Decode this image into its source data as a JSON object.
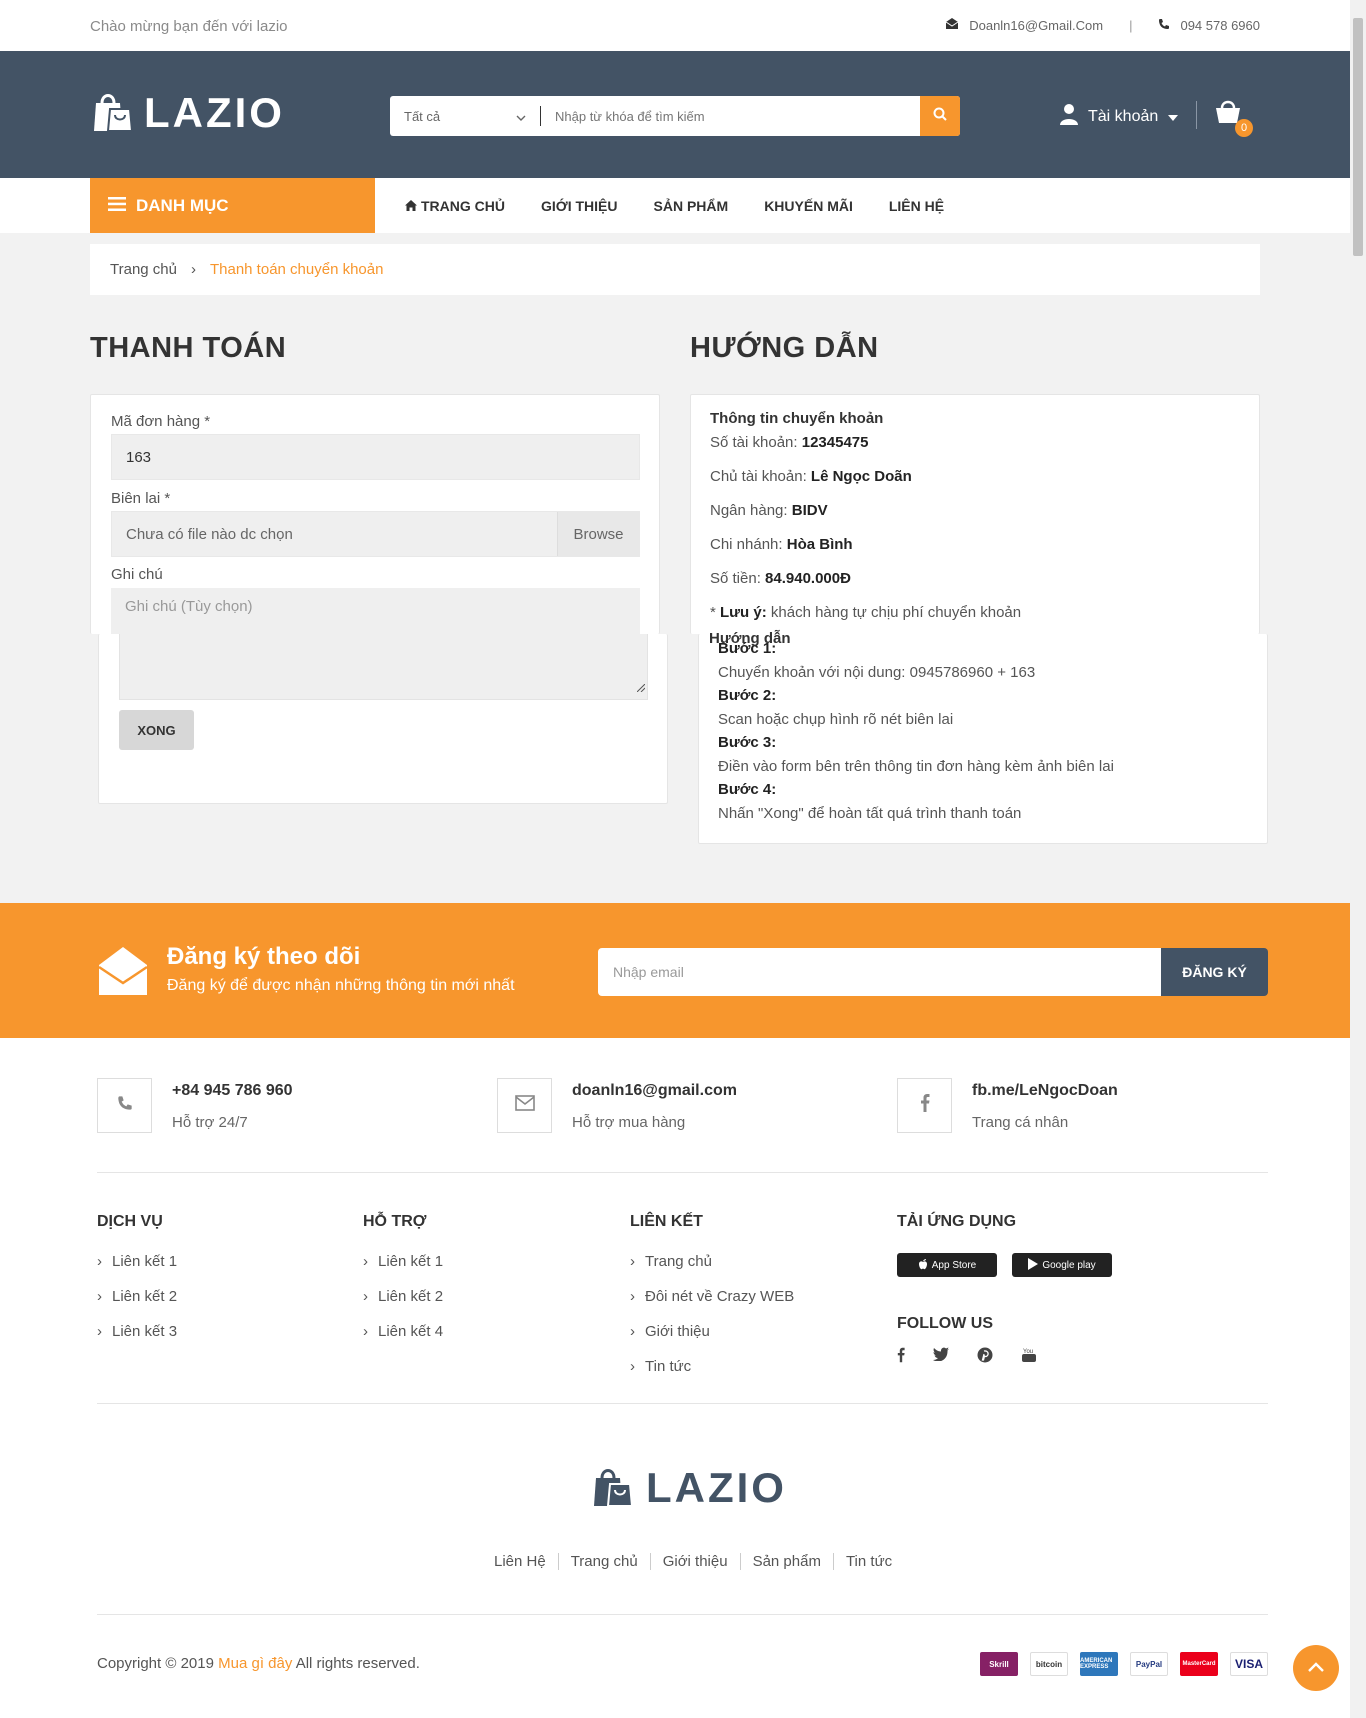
{
  "topbar": {
    "welcome": "Chào mừng bạn đến với lazio",
    "email": "Doanln16@Gmail.Com",
    "phone": "094 578 6960"
  },
  "header": {
    "logo": "LAZIO",
    "search_category": "Tất cả",
    "search_placeholder": "Nhập từ khóa để tìm kiếm",
    "account_label": "Tài khoản",
    "cart_count": "0",
    "brand_color": "#435365",
    "accent_color": "#f7962d"
  },
  "nav": {
    "category_label": "DANH MỤC",
    "items": [
      "TRANG CHỦ",
      "GIỚI THIỆU",
      "SẢN PHẨM",
      "KHUYẾN MÃI",
      "LIÊN HỆ"
    ]
  },
  "breadcrumb": {
    "home": "Trang chủ",
    "current": "Thanh toán chuyển khoản"
  },
  "payment": {
    "heading": "THANH TOÁN",
    "order_label": "Mã đơn hàng *",
    "order_value": "163",
    "receipt_label": "Biên lai *",
    "receipt_value": "Chưa có file nào dc chọn",
    "browse_label": "Browse",
    "note_label": "Ghi chú",
    "note_placeholder": "Ghi chú (Tùy chọn)",
    "submit_label": "XONG"
  },
  "guide": {
    "heading": "HƯỚNG DẪN",
    "info_title": "Thông tin chuyển khoản",
    "account_no_label": "Số tài khoản:",
    "account_no": "12345475",
    "owner_label": "Chủ tài khoản:",
    "owner": "Lê Ngọc Doãn",
    "bank_label": "Ngân hàng:",
    "bank": "BIDV",
    "branch_label": "Chi nhánh:",
    "branch": "Hòa Bình",
    "amount_label": "Số tiền:",
    "amount": "84.940.000Đ",
    "note_label": "Lưu ý:",
    "note": "khách hàng tự chịu phí chuyển khoản",
    "steps_title": "Hướng dẫn",
    "steps": [
      {
        "title": "Bước 1:",
        "text": "Chuyển khoản với nội dung: 0945786960 + 163"
      },
      {
        "title": "Bước 2:",
        "text": "Scan hoặc chụp hình rõ nét biên lai"
      },
      {
        "title": "Bước 3:",
        "text": "Điền vào form bên trên thông tin đơn hàng kèm ảnh biên lai"
      },
      {
        "title": "Bước 4:",
        "text": "Nhấn \"Xong\" để hoàn tất quá trình thanh toán"
      }
    ]
  },
  "subscribe": {
    "title": "Đăng ký theo dõi",
    "subtitle": "Đăng ký để được nhận những thông tin mới nhất",
    "placeholder": "Nhập email",
    "button": "ĐĂNG KÝ"
  },
  "contacts": [
    {
      "title": "+84 945 786 960",
      "sub": "Hỗ trợ 24/7"
    },
    {
      "title": "doanln16@gmail.com",
      "sub": "Hỗ trợ mua hàng"
    },
    {
      "title": "fb.me/LeNgocDoan",
      "sub": "Trang cá nhân"
    }
  ],
  "footer_cols": {
    "dichvu": {
      "title": "DỊCH VỤ",
      "items": [
        "Liên kết 1",
        "Liên kết 2",
        "Liên kết 3"
      ]
    },
    "hotro": {
      "title": "HỖ TRỢ",
      "items": [
        "Liên kết 1",
        "Liên kết 2",
        "Liên kết 4"
      ]
    },
    "lienket": {
      "title": "LIÊN KẾT",
      "items": [
        "Trang chủ",
        "Đôi nét về Crazy WEB",
        "Giới thiệu",
        "Tin tức"
      ]
    },
    "app": {
      "title": "TẢI ỨNG DỤNG",
      "appstore": "App Store",
      "googleplay": "Google play",
      "follow": "FOLLOW US"
    }
  },
  "footer": {
    "logo": "LAZIO",
    "links": [
      "Liên Hệ",
      "Trang chủ",
      "Giới thiệu",
      "Sản phẩm",
      "Tin tức"
    ],
    "copyright_pre": "Copyright © 2019",
    "copyright_brand": "Mua gì đây",
    "copyright_post": "All rights reserved.",
    "payments": [
      "Skrill",
      "bitcoin",
      "AMERICAN EXPRESS",
      "PayPal",
      "MasterCard",
      "VISA"
    ]
  }
}
